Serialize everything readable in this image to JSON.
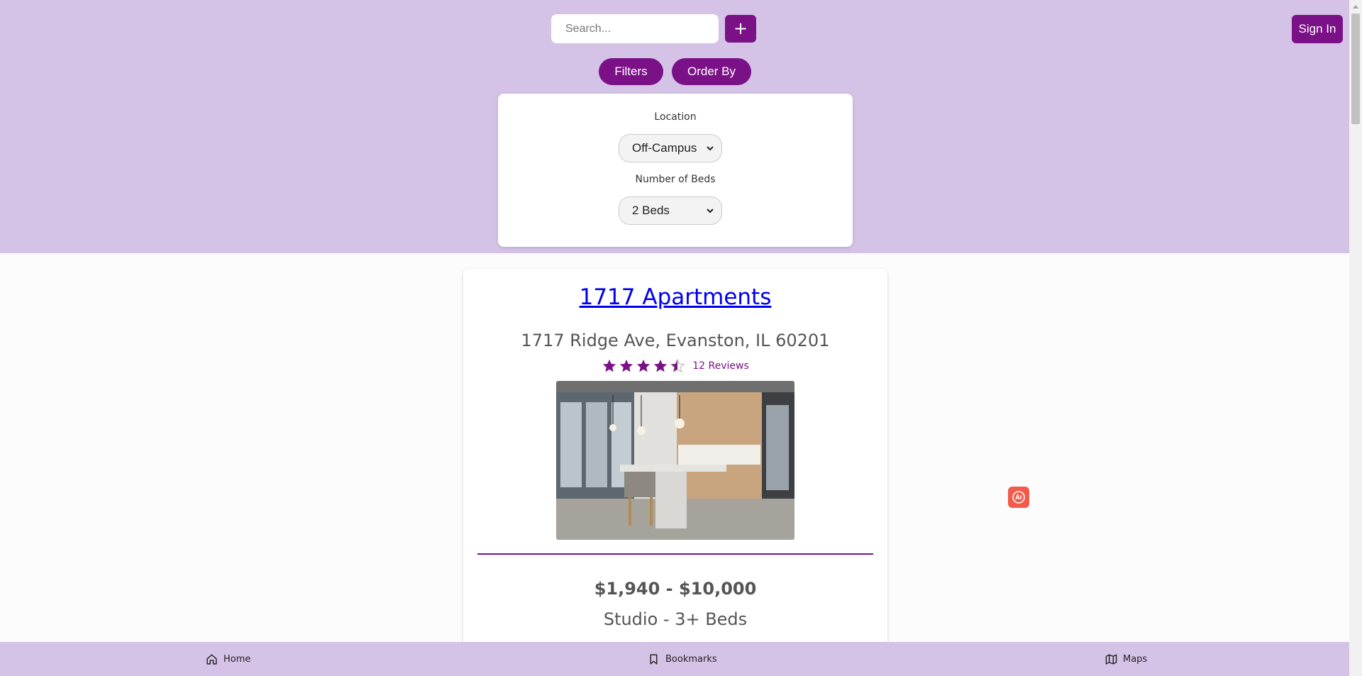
{
  "header": {
    "search": {
      "placeholder": "Search...",
      "value": ""
    },
    "add_label": "+",
    "sign_in_label": "Sign In",
    "filters_label": "Filters",
    "order_by_label": "Order By"
  },
  "filter_panel": {
    "location_label": "Location",
    "location_value": "Off-Campus",
    "beds_label": "Number of Beds",
    "beds_value": "2 Beds"
  },
  "listing": {
    "name": "1717 Apartments",
    "address": "1717 Ridge Ave, Evanston, IL 60201",
    "rating": 4.5,
    "rating_max": 5,
    "reviews": "12 Reviews",
    "price": "$1,940 - $10,000",
    "beds": "Studio - 3+ Beds"
  },
  "bottom_nav": {
    "items": [
      {
        "label": "Home",
        "icon": "home-icon"
      },
      {
        "label": "Bookmarks",
        "icon": "bookmark-icon"
      },
      {
        "label": "Maps",
        "icon": "map-icon"
      }
    ]
  },
  "colors": {
    "accent": "#7b1187",
    "header_bg": "#d5c2e7",
    "link": "#0000ee",
    "ai_badge": "#f25a4a"
  }
}
